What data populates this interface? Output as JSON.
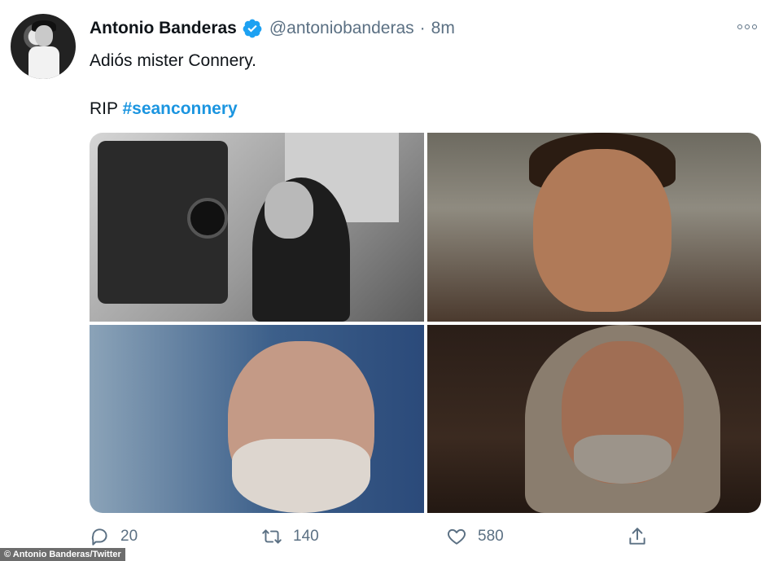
{
  "tweet": {
    "display_name": "Antonio Banderas",
    "handle": "@antoniobanderas",
    "separator": "·",
    "time": "8m",
    "line1": "Adiós mister Connery.",
    "line2_prefix": "RIP ",
    "hashtag": "#seanconnery",
    "verified_color": "#1da1f2",
    "icons": {
      "more": "more-options-icon",
      "reply": "reply-icon",
      "retweet": "retweet-icon",
      "like": "like-icon",
      "share": "share-icon"
    }
  },
  "media": {
    "photo_count": 4
  },
  "stats": {
    "replies": "20",
    "retweets": "140",
    "likes": "580"
  },
  "credit": "© Antonio Banderas/Twitter"
}
